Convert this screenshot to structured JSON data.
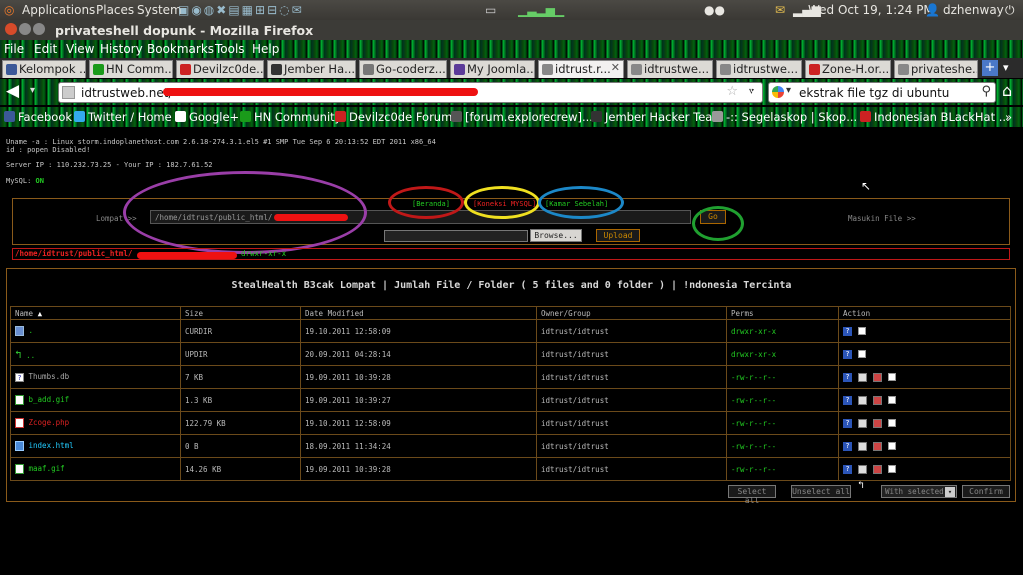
{
  "top_panel": {
    "applications": "Applications",
    "places": "Places",
    "system": "System",
    "clock": "Wed Oct 19,  1:24 PM",
    "user": "dzhenway"
  },
  "window": {
    "title": "privateshell dopunk - Mozilla Firefox"
  },
  "menu": [
    "File",
    "Edit",
    "View",
    "History",
    "Bookmarks",
    "Tools",
    "Help"
  ],
  "tabs": [
    {
      "label": "Kelompok ...",
      "color": "#3b5998"
    },
    {
      "label": "HN Comm...",
      "color": "#1a9a1a"
    },
    {
      "label": "Devilzc0de...",
      "color": "#c22"
    },
    {
      "label": "Jember Ha...",
      "color": "#333"
    },
    {
      "label": "Go-coderz...",
      "color": "#777"
    },
    {
      "label": "My Joomla...",
      "color": "#5b3b99"
    },
    {
      "label": "idtrust.r...",
      "color": "#888"
    },
    {
      "label": "idtrustwe...",
      "color": "#888"
    },
    {
      "label": "idtrustwe...",
      "color": "#888"
    },
    {
      "label": "Zone-H.or...",
      "color": "#c22"
    },
    {
      "label": "privateshe...",
      "color": "#888"
    }
  ],
  "nav": {
    "url": "idtrustweb.net/",
    "search": "ekstrak file tgz di ubuntu"
  },
  "bookmarks": [
    {
      "label": "Facebook",
      "color": "#3b5998"
    },
    {
      "label": "Twitter / Home",
      "color": "#33aaee"
    },
    {
      "label": "Google+",
      "color": "#fff"
    },
    {
      "label": "HN Community",
      "color": "#1a9a1a"
    },
    {
      "label": "Devilzc0de Forum",
      "color": "#c22"
    },
    {
      "label": "[forum.explorecrew]...",
      "color": "#555"
    },
    {
      "label": "Jember Hacker Team",
      "color": "#333"
    },
    {
      "label": "-:: Segelaskop | Skop...",
      "color": "#999"
    },
    {
      "label": "Indonesian BLackHat ...",
      "color": "#c22"
    }
  ],
  "server": {
    "uname": "Uname -a : Linux storm.indoplanethost.com 2.6.18-274.3.1.el5 #1 SMP Tue Sep 6 20:13:52 EDT 2011 x86_64",
    "id": "id : popen Disabled!",
    "ip": "Server IP : 110.232.73.25 - Your IP : 182.7.61.52",
    "mysql_label": "MySQL:",
    "mysql_status": "ON"
  },
  "shell": {
    "nav_links": [
      "[Beranda]",
      "[Koneksi MYSQL]",
      "[Kamar Sebelah]"
    ],
    "jump_label": "Lompat >>",
    "path_value": "/home/idtrust/public_html/",
    "go_label": "Go",
    "file_label": "Masukin File >>",
    "browse_label": "Browse...",
    "upload_label": "Upload",
    "current_path": "/home/idtrust/public_html/",
    "current_perms": "drwxr-xr-x",
    "banner": "StealHealth B3cak Lompat | Jumlah File / Folder ( 5 files and 0 folder ) | !ndonesia Tercinta",
    "columns": [
      "Name",
      "Size",
      "Date Modified",
      "Owner/Group",
      "Perms",
      "Action"
    ],
    "rows": [
      {
        "name": ".",
        "size": "CURDIR",
        "date": "19.10.2011 12:58:09",
        "owner": "idtrust/idtrust",
        "perms": "drwxr-xr-x",
        "icon": "folder-icon"
      },
      {
        "name": "..",
        "size": "UPDIR",
        "date": "20.09.2011 04:28:14",
        "owner": "idtrust/idtrust",
        "perms": "drwxr-xr-x",
        "icon": "up-icon"
      },
      {
        "name": "Thumbs.db",
        "size": "7 KB",
        "date": "19.09.2011 10:39:28",
        "owner": "idtrust/idtrust",
        "perms": "-rw-r--r--",
        "icon": "file-icon"
      },
      {
        "name": "b_add.gif",
        "size": "1.3 KB",
        "date": "19.09.2011 10:39:27",
        "owner": "idtrust/idtrust",
        "perms": "-rw-r--r--",
        "icon": "image-icon"
      },
      {
        "name": "Zcoge.php",
        "size": "122.79 KB",
        "date": "19.10.2011 12:58:09",
        "owner": "idtrust/idtrust",
        "perms": "-rw-r--r--",
        "icon": "php-icon"
      },
      {
        "name": "index.html",
        "size": "0 B",
        "date": "18.09.2011 11:34:24",
        "owner": "idtrust/idtrust",
        "perms": "-rw-r--r--",
        "icon": "html-icon"
      },
      {
        "name": "maaf.gif",
        "size": "14.26 KB",
        "date": "19.09.2011 10:39:28",
        "owner": "idtrust/idtrust",
        "perms": "-rw-r--r--",
        "icon": "image-icon"
      }
    ],
    "select_all": "Select all",
    "unselect_all": "Unselect all",
    "with_selected": "With selected:",
    "confirm": "Confirm"
  }
}
